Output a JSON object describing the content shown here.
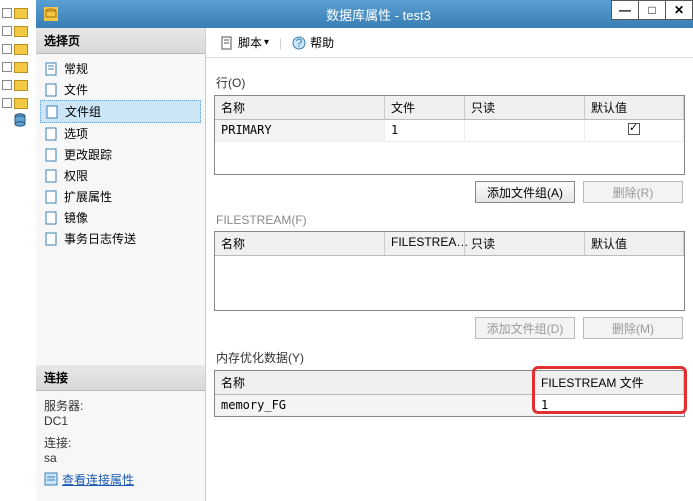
{
  "window": {
    "title": "数据库属性 - test3"
  },
  "sidebar": {
    "select_page_header": "选择页",
    "items": [
      {
        "label": "常规"
      },
      {
        "label": "文件"
      },
      {
        "label": "文件组"
      },
      {
        "label": "选项"
      },
      {
        "label": "更改跟踪"
      },
      {
        "label": "权限"
      },
      {
        "label": "扩展属性"
      },
      {
        "label": "镜像"
      },
      {
        "label": "事务日志传送"
      }
    ],
    "selected_index": 2,
    "connection_header": "连接",
    "server_label": "服务器:",
    "server_value": "DC1",
    "conn_label": "连接:",
    "conn_value": "sa",
    "view_connection_props": "查看连接属性"
  },
  "toolbar": {
    "script_label": "脚本",
    "help_label": "帮助"
  },
  "rows_group": {
    "label": "行(O)",
    "columns": [
      "名称",
      "文件",
      "只读",
      "默认值"
    ],
    "rows": [
      {
        "name": "PRIMARY",
        "files": "1",
        "readonly": false,
        "default": true
      }
    ],
    "add_btn": "添加文件组(A)",
    "remove_btn": "删除(R)"
  },
  "filestream_group": {
    "label": "FILESTREAM(F)",
    "columns": [
      "名称",
      "FILESTREA…",
      "只读",
      "默认值"
    ],
    "add_btn": "添加文件组(D)",
    "remove_btn": "删除(M)"
  },
  "memory_group": {
    "label": "内存优化数据(Y)",
    "columns": [
      "名称",
      "FILESTREAM 文件"
    ],
    "rows": [
      {
        "name": "memory_FG",
        "files": "1"
      }
    ]
  }
}
